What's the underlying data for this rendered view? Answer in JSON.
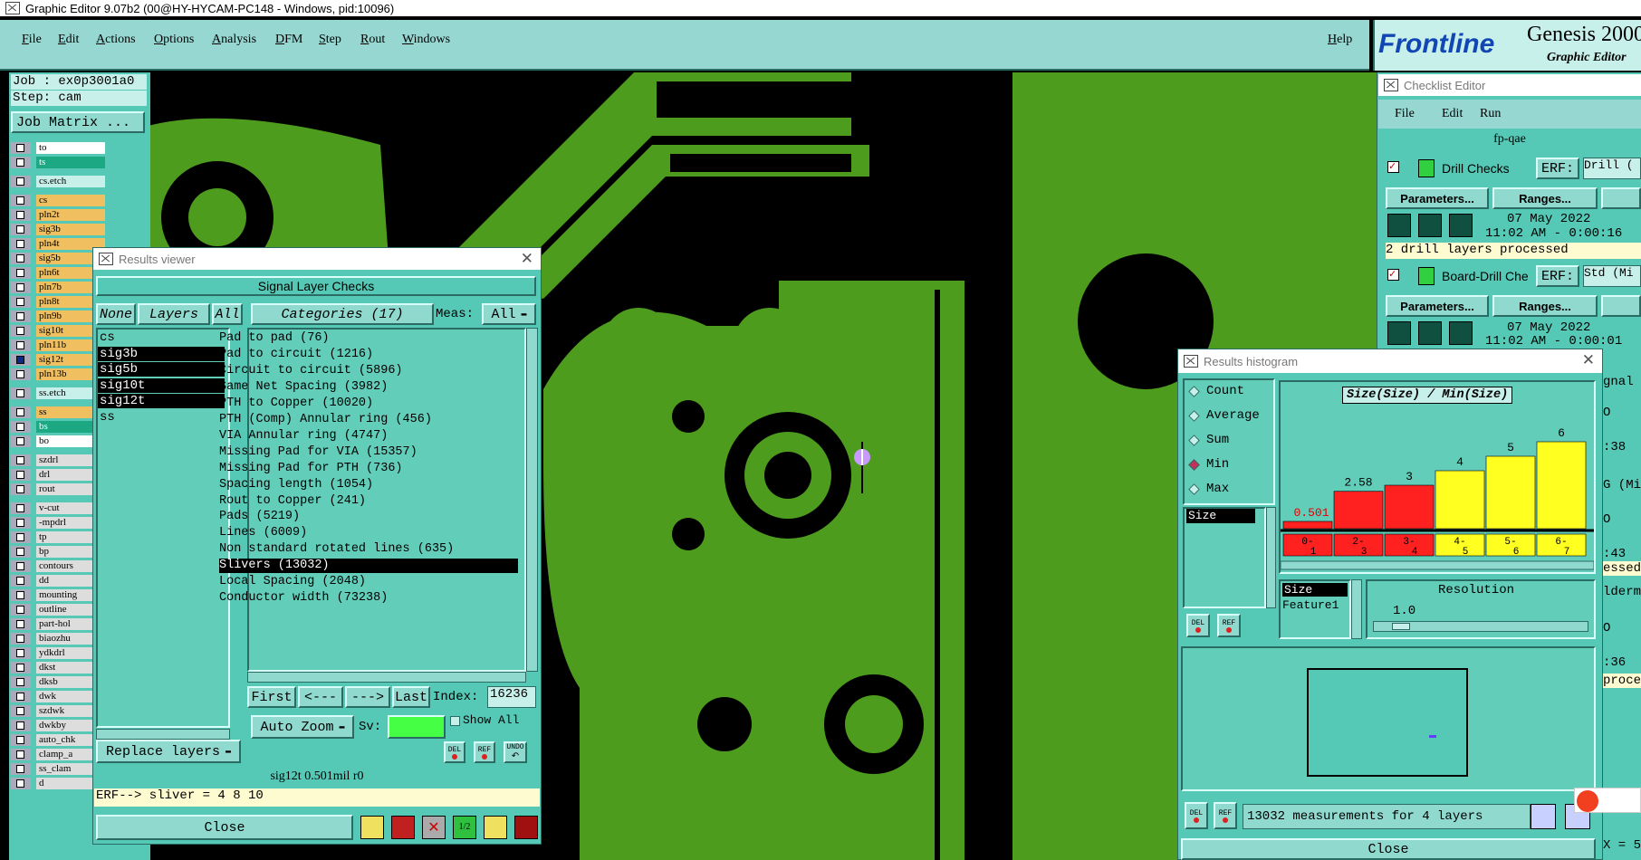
{
  "app": {
    "title": "Graphic Editor 9.07b2 (00@HY-HYCAM-PC148 - Windows, pid:10096)"
  },
  "menubar": {
    "items": [
      "File",
      "Edit",
      "Actions",
      "Options",
      "Analysis",
      "DFM",
      "Step",
      "Rout",
      "Windows"
    ],
    "help": "Help"
  },
  "brand": {
    "logo": "Frontline",
    "product": "Genesis 2000",
    "subtitle": "Graphic Editor"
  },
  "job": {
    "job_line": "Job : ex0p3001a0",
    "step_line": "Step: cam",
    "matrix_button": "Job Matrix ..."
  },
  "layers": [
    {
      "name": "to",
      "style": "white",
      "checked": false
    },
    {
      "name": "ts",
      "style": "green",
      "checked": false
    },
    {
      "name": "cs.etch",
      "style": "cyan",
      "checked": false,
      "gap_before": true
    },
    {
      "name": "cs",
      "style": "orange",
      "checked": false,
      "gap_before": true
    },
    {
      "name": "pln2t",
      "style": "orange",
      "checked": false
    },
    {
      "name": "sig3b",
      "style": "orange",
      "checked": false
    },
    {
      "name": "pln4t",
      "style": "orange",
      "checked": false
    },
    {
      "name": "sig5b",
      "style": "orange",
      "checked": false
    },
    {
      "name": "pln6t",
      "style": "orange",
      "checked": false
    },
    {
      "name": "pln7b",
      "style": "orange",
      "checked": false
    },
    {
      "name": "pln8t",
      "style": "orange",
      "checked": false
    },
    {
      "name": "pln9b",
      "style": "orange",
      "checked": false
    },
    {
      "name": "sig10t",
      "style": "orange",
      "checked": false
    },
    {
      "name": "pln11b",
      "style": "orange",
      "checked": false
    },
    {
      "name": "sig12t",
      "style": "orange",
      "checked": true
    },
    {
      "name": "pln13b",
      "style": "orange",
      "checked": false
    },
    {
      "name": "ss.etch",
      "style": "cyan",
      "checked": false,
      "gap_before": true
    },
    {
      "name": "ss",
      "style": "orange",
      "checked": false,
      "gap_before": true
    },
    {
      "name": "bs",
      "style": "green",
      "checked": false
    },
    {
      "name": "bo",
      "style": "white",
      "checked": false
    },
    {
      "name": "szdrl",
      "style": "grey",
      "checked": false,
      "gap_before": true
    },
    {
      "name": "drl",
      "style": "grey",
      "checked": false
    },
    {
      "name": "rout",
      "style": "grey",
      "checked": false
    },
    {
      "name": "v-cut",
      "style": "grey",
      "checked": false,
      "gap_before": true
    },
    {
      "name": "-mpdrl",
      "style": "grey",
      "checked": false
    },
    {
      "name": "tp",
      "style": "grey",
      "checked": false
    },
    {
      "name": "bp",
      "style": "grey",
      "checked": false
    },
    {
      "name": "contours",
      "style": "grey",
      "checked": false
    },
    {
      "name": "dd",
      "style": "grey",
      "checked": false
    },
    {
      "name": "mounting",
      "style": "grey",
      "checked": false
    },
    {
      "name": "outline",
      "style": "grey",
      "checked": false
    },
    {
      "name": "part-hol",
      "style": "grey",
      "checked": false
    },
    {
      "name": "biaozhu",
      "style": "grey",
      "checked": false
    },
    {
      "name": "ydkdrl",
      "style": "grey",
      "checked": false
    },
    {
      "name": "dkst",
      "style": "grey",
      "checked": false
    },
    {
      "name": "dksb",
      "style": "grey",
      "checked": false
    },
    {
      "name": "dwk",
      "style": "grey",
      "checked": false
    },
    {
      "name": "szdwk",
      "style": "grey",
      "checked": false
    },
    {
      "name": "dwkby",
      "style": "grey",
      "checked": false
    },
    {
      "name": "auto_chk",
      "style": "grey",
      "checked": false
    },
    {
      "name": "clamp_a",
      "style": "grey",
      "checked": false
    },
    {
      "name": "ss_clam",
      "style": "grey",
      "checked": false
    },
    {
      "name": "d",
      "style": "grey",
      "checked": false
    }
  ],
  "results_viewer": {
    "title": "Results viewer",
    "header": "Signal Layer Checks",
    "none_btn": "None",
    "layers_btn": "Layers",
    "all_btn": "All",
    "categories_btn": "Categories (17)",
    "meas_label": "Meas:",
    "meas_value": "All",
    "layer_list": [
      {
        "name": "cs",
        "selected": false
      },
      {
        "name": "sig3b",
        "selected": true
      },
      {
        "name": "sig5b",
        "selected": true
      },
      {
        "name": "sig10t",
        "selected": true
      },
      {
        "name": "sig12t",
        "selected": true
      },
      {
        "name": "ss",
        "selected": false
      }
    ],
    "categories": [
      {
        "label": "Pad to pad (76)",
        "selected": false
      },
      {
        "label": "Pad to circuit (1216)",
        "selected": false
      },
      {
        "label": "Circuit to circuit (5896)",
        "selected": false
      },
      {
        "label": "Same Net Spacing (3982)",
        "selected": false
      },
      {
        "label": "PTH to Copper (10020)",
        "selected": false
      },
      {
        "label": "PTH (Comp) Annular ring (456)",
        "selected": false
      },
      {
        "label": "VIA Annular ring (4747)",
        "selected": false
      },
      {
        "label": "Missing Pad for VIA (15357)",
        "selected": false
      },
      {
        "label": "Missing Pad for PTH (736)",
        "selected": false
      },
      {
        "label": "Spacing length (1054)",
        "selected": false
      },
      {
        "label": "Rout to Copper (241)",
        "selected": false
      },
      {
        "label": "Pads (5219)",
        "selected": false
      },
      {
        "label": "Lines (6009)",
        "selected": false
      },
      {
        "label": "Non standard rotated lines (635)",
        "selected": false
      },
      {
        "label": "Slivers (13032)",
        "selected": true
      },
      {
        "label": "Local Spacing (2048)",
        "selected": false
      },
      {
        "label": "Conductor width (73238)",
        "selected": false
      }
    ],
    "first_btn": "First",
    "prev_btn": "<---",
    "next_btn": "--->",
    "last_btn": "Last",
    "index_label": "Index:",
    "index_value": "16236",
    "auto_zoom": "Auto Zoom",
    "sv_label": "Sv:",
    "show_all": "Show All",
    "del": "DEL",
    "ref": "REF",
    "undo": "UNDO",
    "replace_layers": "Replace layers",
    "status": "sig12t 0.501mil  r0",
    "erf_line": "ERF--> sliver = 4 8 10",
    "close": "Close"
  },
  "checklist": {
    "title": "Checklist Editor",
    "menu": [
      "File",
      "Edit",
      "Run"
    ],
    "name": "fp-qae",
    "checks": [
      {
        "label": "Drill Checks",
        "erf": "ERF:",
        "erf_value": "Drill (",
        "params": "Parameters...",
        "ranges": "Ranges...",
        "date": "07 May 2022",
        "time": "11:02 AM - 0:00:16",
        "status": "2 drill layers processed"
      },
      {
        "label": "Board-Drill Che",
        "erf": "ERF:",
        "erf_value": "Std (Mi",
        "params": "Parameters...",
        "ranges": "Ranges...",
        "date": "07 May 2022",
        "time": "11:02 AM - 0:00:01",
        "status": ""
      }
    ],
    "right_fragments": [
      "gnal",
      "O",
      ":38",
      "G (Mi",
      "O",
      ":43",
      "essed",
      "lderm",
      "O",
      ":36",
      "proce",
      "X = 5"
    ]
  },
  "histogram": {
    "title": "Results histogram",
    "modes": [
      {
        "label": "Count",
        "selected": false
      },
      {
        "label": "Average",
        "selected": false
      },
      {
        "label": "Sum",
        "selected": false
      },
      {
        "label": "Min",
        "selected": true
      },
      {
        "label": "Max",
        "selected": false
      }
    ],
    "chart_title": "Size(Size) / Min(Size)",
    "measure_list": [
      "Size"
    ],
    "bins": [
      {
        "label_top": "0-",
        "label_bottom": "1",
        "value": 0.501,
        "value_label": "0.501",
        "color": "#ff2020"
      },
      {
        "label_top": "2-",
        "label_bottom": "3",
        "value": 2.58,
        "value_label": "2.58",
        "color": "#ff2020"
      },
      {
        "label_top": "3-",
        "label_bottom": "4",
        "value": 3,
        "value_label": "3",
        "color": "#ff2020"
      },
      {
        "label_top": "4-",
        "label_bottom": "5",
        "value": 4,
        "value_label": "4",
        "color": "#ffff20"
      },
      {
        "label_top": "5-",
        "label_bottom": "6",
        "value": 5,
        "value_label": "5",
        "color": "#ffff20"
      },
      {
        "label_top": "6-",
        "label_bottom": "7",
        "value": 6,
        "value_label": "6",
        "color": "#ffff20"
      }
    ],
    "attr_list": [
      "Size",
      "Feature1"
    ],
    "resolution_label": "Resolution",
    "resolution_value": "1.0",
    "del": "DEL",
    "ref": "REF",
    "summary": "13032 measurements for 4 layers",
    "close": "Close"
  },
  "colors": {
    "copper": "#4e9c1e",
    "panel": "#56c9b6",
    "menubar": "#96d7d2",
    "selection": "#000000"
  }
}
